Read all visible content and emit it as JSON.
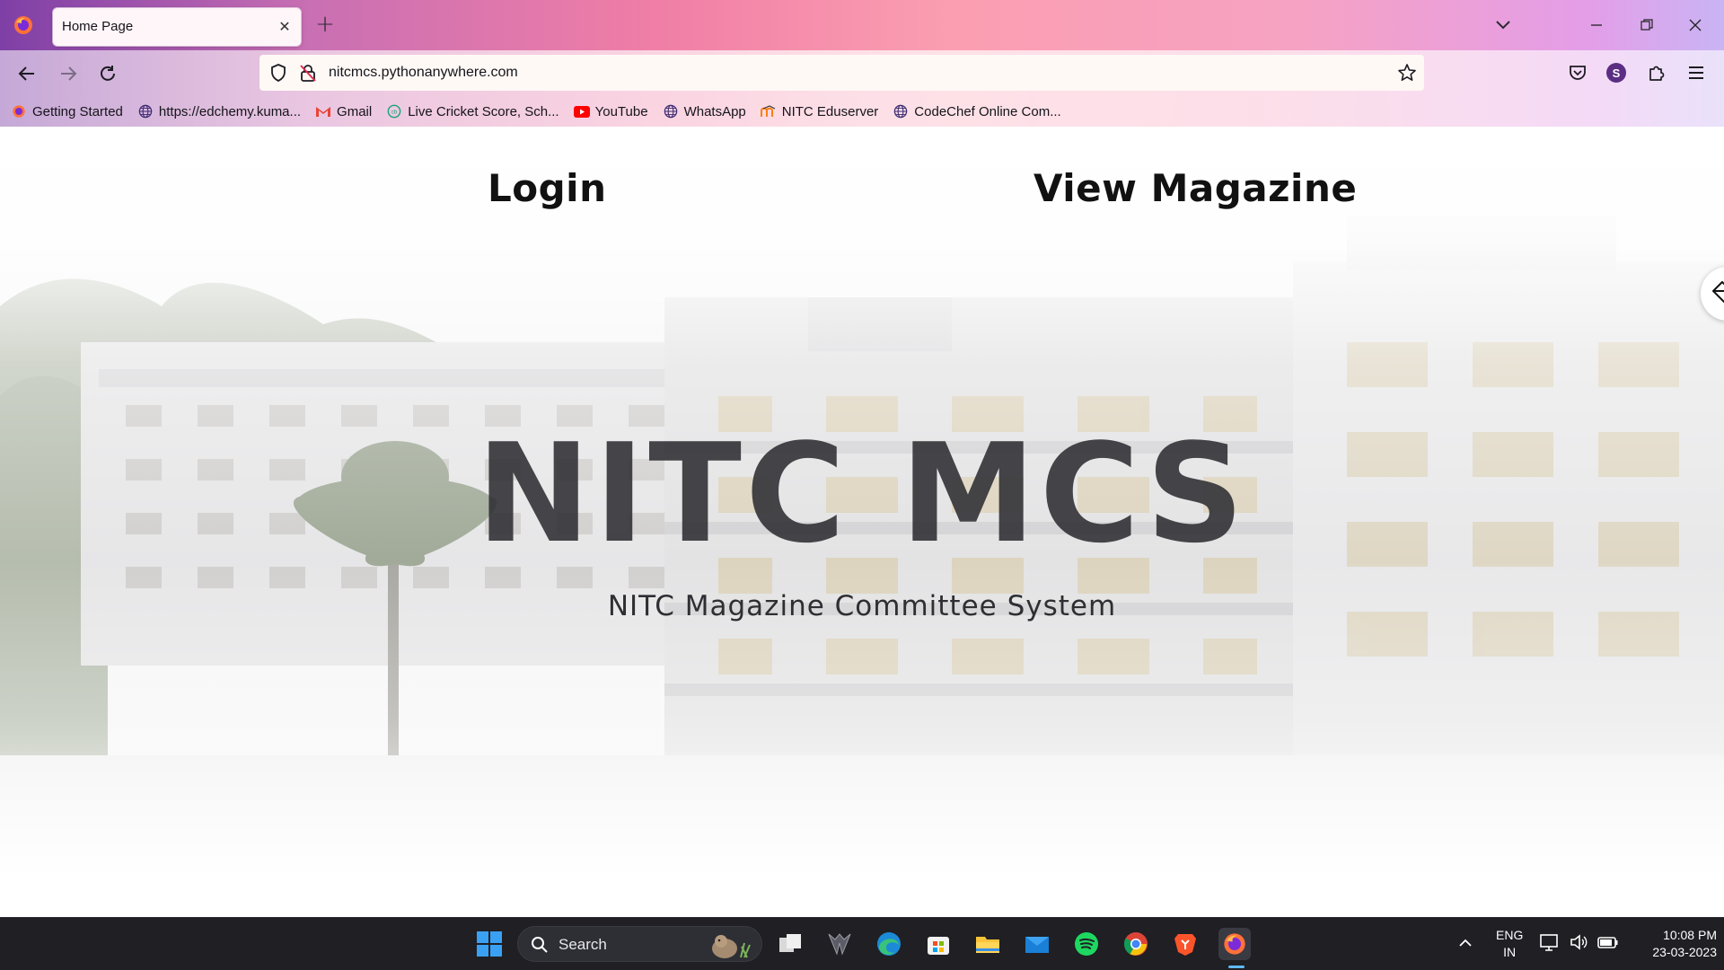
{
  "browser": {
    "tab": {
      "title": "Home Page"
    },
    "url": "nitcmcs.pythonanywhere.com",
    "account_initial": "S",
    "bookmarks": [
      {
        "label": "Getting Started",
        "icon": "firefox-icon"
      },
      {
        "label": "https://edchemy.kuma...",
        "icon": "globe-icon"
      },
      {
        "label": "Gmail",
        "icon": "gmail-icon"
      },
      {
        "label": "Live Cricket Score, Sch...",
        "icon": "cricbuzz-icon"
      },
      {
        "label": "YouTube",
        "icon": "youtube-icon"
      },
      {
        "label": "WhatsApp",
        "icon": "globe-icon"
      },
      {
        "label": "NITC Eduserver",
        "icon": "moodle-icon"
      },
      {
        "label": "CodeChef Online Com...",
        "icon": "globe-icon"
      }
    ]
  },
  "page": {
    "nav": {
      "login": "Login",
      "view_magazine": "View Magazine"
    },
    "hero": {
      "title": "NITC MCS",
      "subtitle": "NITC Magazine Committee System"
    }
  },
  "taskbar": {
    "search_label": "Search",
    "apps": [
      "start-icon",
      "task-view-icon",
      "armoury-icon",
      "edge-icon",
      "microsoft-store-icon",
      "file-explorer-icon",
      "mail-icon",
      "spotify-icon",
      "chrome-icon",
      "brave-icon",
      "firefox-icon"
    ],
    "tray": {
      "lang_line1": "ENG",
      "lang_line2": "IN",
      "time": "10:08 PM",
      "date": "23-03-2023"
    }
  },
  "colors": {
    "accent_firefox": "#ff7139",
    "taskbar_bg": "#1f1f24",
    "hero_text": "#2e2e33"
  }
}
